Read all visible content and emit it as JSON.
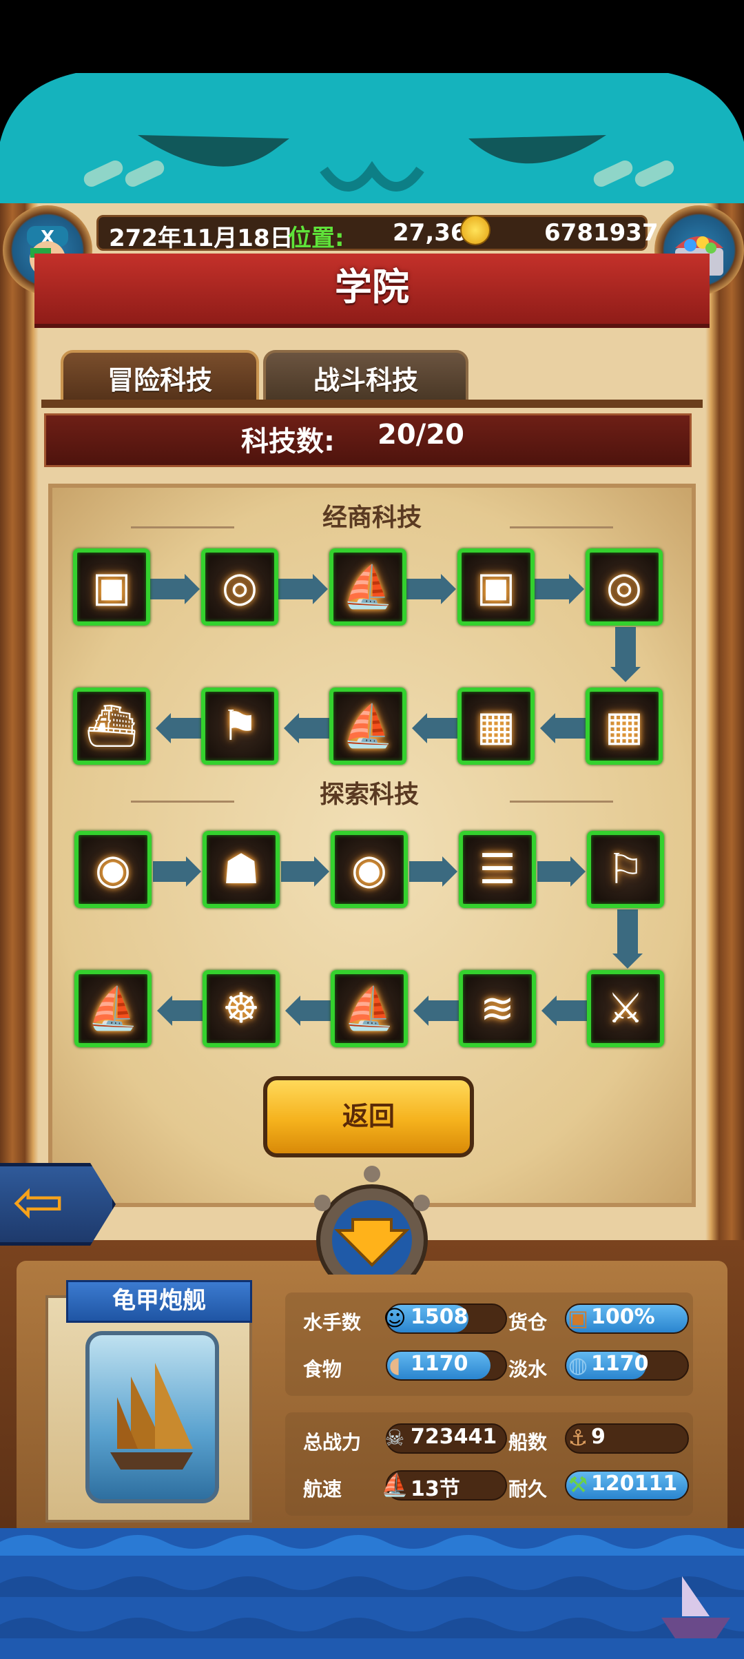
{
  "header": {
    "date": "272年11月18日",
    "position_label": "位置:",
    "position_value": "27,36",
    "coins": "6781937"
  },
  "title": "学院",
  "tabs": [
    {
      "label": "冒险科技",
      "selected": true
    },
    {
      "label": "战斗科技",
      "selected": false
    }
  ],
  "tech_count": {
    "label": "科技数:",
    "value": "20/20"
  },
  "sections": [
    {
      "title": "经商科技"
    },
    {
      "title": "探索科技"
    }
  ],
  "tech_icons": {
    "row1": [
      "treasure-chest-up-icon",
      "coins-down-icon",
      "sailboat-icon",
      "treasure-chest-up-icon",
      "coins-down-icon"
    ],
    "row2": [
      "steamship-icon",
      "broken-sail-icon",
      "sailboat-icon",
      "crates-up-icon",
      "crates-up-icon"
    ],
    "row3": [
      "compass-dial-icon",
      "crew-icon",
      "compass-dial-icon",
      "speech-bubbles-icon",
      "flag-icon"
    ],
    "row4": [
      "tall-ship-icon",
      "ship-wheel-icon",
      "sailboat-icon",
      "fish-up-icon",
      "swordfish-icon"
    ]
  },
  "return_button": "返回",
  "ship": {
    "name": "龟甲炮舰",
    "stats": {
      "sailors_label": "水手数",
      "sailors": "1508",
      "cargo_label": "货仓",
      "cargo": "100%",
      "food_label": "食物",
      "food": "1170",
      "water_label": "淡水",
      "water": "1170",
      "power_label": "总战力",
      "power": "723441",
      "ships_label": "船数",
      "ships": "9",
      "speed_label": "航速",
      "speed": "13节",
      "durability_label": "耐久",
      "durability": "120111"
    }
  },
  "colors": {
    "title_red": "#c4312a",
    "tech_border_green": "#34d12e",
    "connector_blue": "#3b6a80",
    "return_button_yellow": "#f5b21d",
    "sea_blue": "#1f5ab0"
  }
}
